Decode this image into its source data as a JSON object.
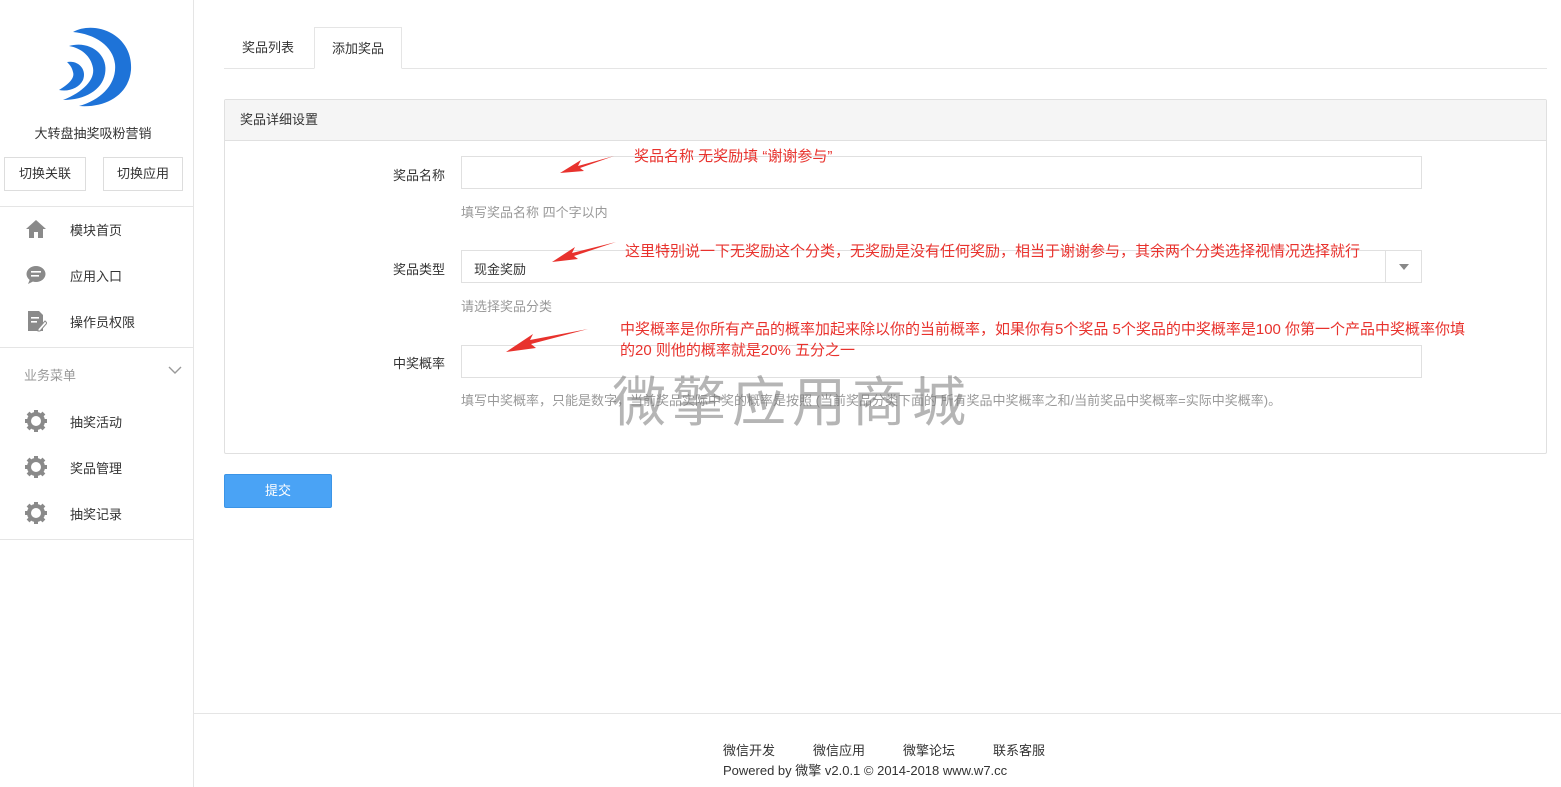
{
  "sidebar": {
    "app_name": "大转盘抽奖吸粉营销",
    "switch_link_label": "切换关联",
    "switch_app_label": "切换应用",
    "nav": [
      {
        "label": "模块首页",
        "icon": "home-icon"
      },
      {
        "label": "应用入口",
        "icon": "chat-bubble-icon"
      },
      {
        "label": "操作员权限",
        "icon": "edit-document-icon"
      }
    ],
    "group_title": "业务菜单",
    "group_items": [
      {
        "label": "抽奖活动",
        "icon": "gear-icon"
      },
      {
        "label": "奖品管理",
        "icon": "gear-icon"
      },
      {
        "label": "抽奖记录",
        "icon": "gear-icon"
      }
    ]
  },
  "tabs": [
    {
      "label": "奖品列表",
      "active": false
    },
    {
      "label": "添加奖品",
      "active": true
    }
  ],
  "panel": {
    "title": "奖品详细设置",
    "name_label": "奖品名称",
    "name_value": "",
    "name_help": "填写奖品名称 四个字以内",
    "type_label": "奖品类型",
    "type_value": "现金奖励",
    "type_help": "请选择奖品分类",
    "prob_label": "中奖概率",
    "prob_value": "",
    "prob_help": "填写中奖概率，只能是数字，当前奖品实际中奖的概率是按照 (当前奖品分类下面的 所有奖品中奖概率之和/当前奖品中奖概率=实际中奖概率)。"
  },
  "submit_label": "提交",
  "annotations": {
    "a1": "奖品名称  无奖励填 “谢谢参与”",
    "a2": "这里特别说一下无奖励这个分类，无奖励是没有任何奖励，相当于谢谢参与，其余两个分类选择视情况选择就行",
    "a3_line1": "中奖概率是你所有产品的概率加起来除以你的当前概率，如果你有5个奖品 5个奖品的中奖概率是100  你第一个产品中奖概率你填",
    "a3_line2": "的20  则他的概率就是20%    五分之一",
    "color": "#e8322d"
  },
  "watermark": "微擎应用商城",
  "footer": {
    "links": [
      "微信开发",
      "微信应用",
      "微擎论坛",
      "联系客服"
    ],
    "powered": "Powered by 微擎 v2.0.1 © 2014-2018 www.w7.cc"
  },
  "colors": {
    "primary": "#4aa3f5",
    "logo_blue": "#1e73d8"
  }
}
